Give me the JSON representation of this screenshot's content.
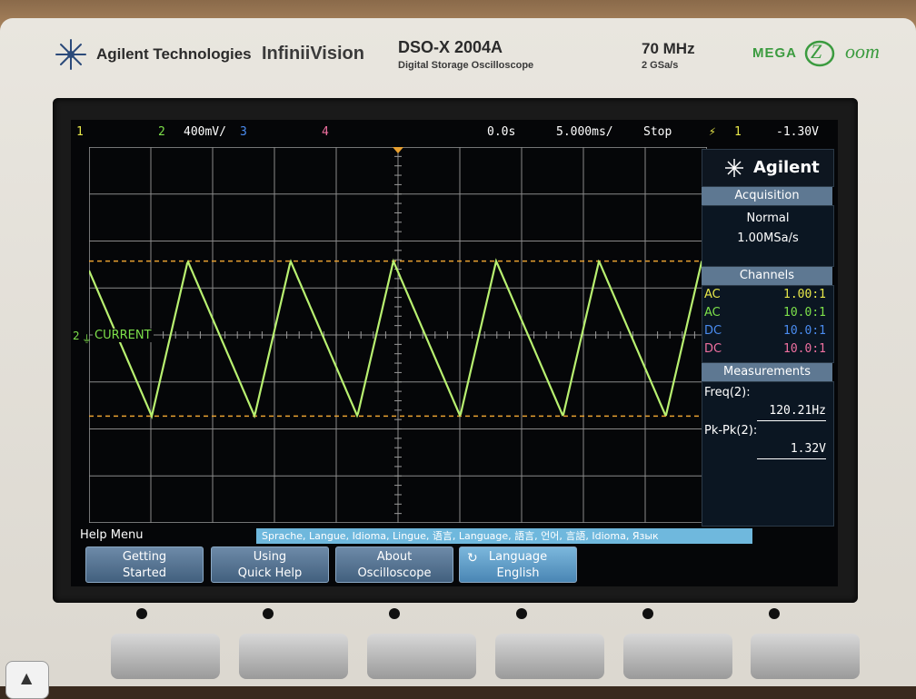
{
  "brand": {
    "company": "Agilent Technologies",
    "series": "InfiniiVision",
    "model": "DSO-X 2004A",
    "description": "Digital Storage Oscilloscope",
    "bandwidth": "70 MHz",
    "sample_rate": "2 GSa/s",
    "mega": "MEGA",
    "zoom_z": "Z",
    "zoom_rest": "oom"
  },
  "status": {
    "ch1": "1",
    "ch2": "2",
    "ch2_scale": "400mV/",
    "ch3": "3",
    "ch4": "4",
    "delay": "0.0s",
    "timebase": "5.000ms/",
    "run_state": "Stop",
    "trigger_source": "1",
    "trigger_level": "-1.30V"
  },
  "colors": {
    "ch1": "#e8e84a",
    "ch2": "#7de04a",
    "ch3": "#4a8cf0",
    "ch4": "#f070a0",
    "trace": "#b8f070",
    "cursor": "#e8a030",
    "grid": "#8a8a8a"
  },
  "trace": {
    "label": "CURRENT",
    "channel": "2",
    "frequency_hz": 120.21,
    "pk_pk_v": 1.32
  },
  "panel": {
    "logo": "Agilent",
    "acquisition_title": "Acquisition",
    "acq_mode": "Normal",
    "acq_rate": "1.00MSa/s",
    "channels_title": "Channels",
    "channels": [
      {
        "coupling": "AC",
        "ratio": "1.00:1"
      },
      {
        "coupling": "AC",
        "ratio": "10.0:1"
      },
      {
        "coupling": "DC",
        "ratio": "10.0:1"
      },
      {
        "coupling": "DC",
        "ratio": "10.0:1"
      }
    ],
    "measurements_title": "Measurements",
    "freq_label": "Freq(2):",
    "freq_value": "120.21Hz",
    "pkpk_label": "Pk-Pk(2):",
    "pkpk_value": "1.32V"
  },
  "help": {
    "title": "Help Menu",
    "languages": "Sprache, Langue, Idioma, Lingue, 语言, Language, 語言, 언어, 言語, Idioma, Язык"
  },
  "softkeys": [
    {
      "line1": "Getting",
      "line2": "Started"
    },
    {
      "line1": "Using",
      "line2": "Quick Help"
    },
    {
      "line1": "About",
      "line2": "Oscilloscope"
    },
    {
      "line1": "Language",
      "line2": "English"
    }
  ]
}
